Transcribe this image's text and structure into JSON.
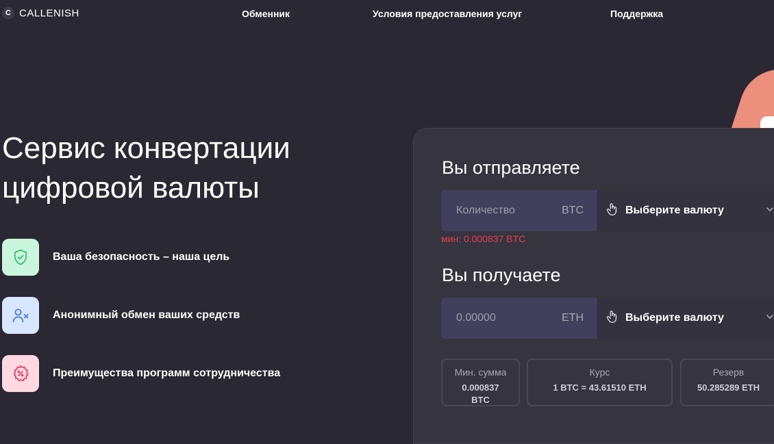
{
  "header": {
    "logo_letter": "C",
    "logo_text": "CALLENISH",
    "nav": [
      "Обменник",
      "Условия предоставления услуг",
      "Поддержка"
    ]
  },
  "hero": {
    "title_lines": [
      "Сервис конвертации",
      "цифровой валюты"
    ]
  },
  "features": [
    {
      "icon": "shield-check-icon",
      "text": "Ваша безопасность – наша цель",
      "color": "#c9f6dd",
      "stroke": "#3fbf73"
    },
    {
      "icon": "user-x-icon",
      "text": "Анонимный обмен ваших средств",
      "color": "#d7e7ff",
      "stroke": "#4b7fe0"
    },
    {
      "icon": "percent-badge-icon",
      "text": "Преимущества программ сотрудничества",
      "color": "#ffd9e2",
      "stroke": "#e0456b"
    }
  ],
  "exchange": {
    "send_label": "Вы отправляете",
    "send_placeholder": "Количество",
    "send_unit": "BTC",
    "send_select": "Выберите валюту",
    "min_note": "мин: 0.000837 BTC",
    "receive_label": "Вы получаете",
    "receive_placeholder": "0.00000",
    "receive_unit": "ETH",
    "receive_select": "Выберите валюту"
  },
  "stats": {
    "min_label": "Мин. сумма",
    "min_value_line1": "0.000837",
    "min_value_line2": "BTC",
    "rate_label": "Курс",
    "rate_value": "1 BTC = 43.61510 ETH",
    "reserve_label": "Резерв",
    "reserve_value": "50.285289 ETH"
  },
  "colors": {
    "background": "#2a2833",
    "card": "#36343f",
    "error": "#e2404f"
  }
}
